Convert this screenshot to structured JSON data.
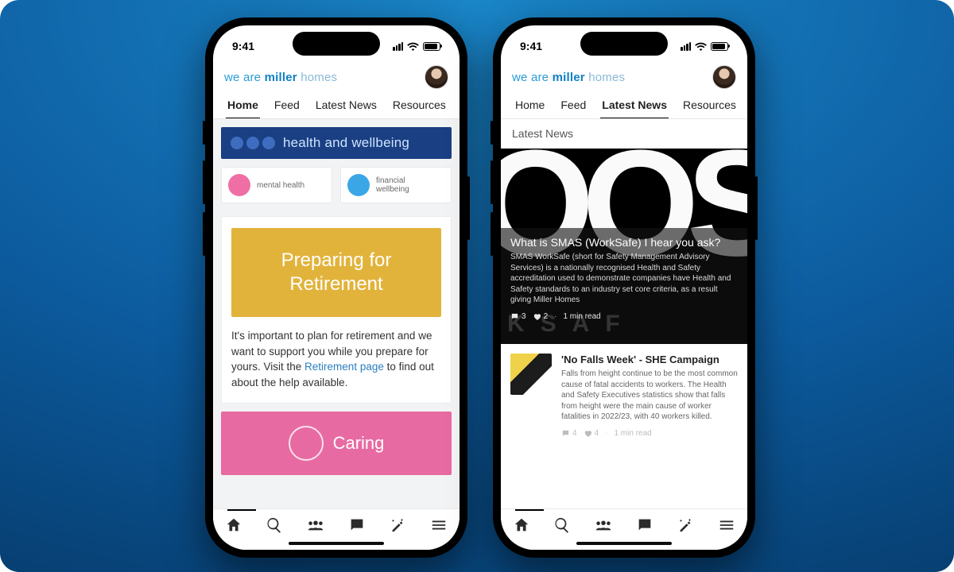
{
  "status": {
    "time": "9:41"
  },
  "brand": {
    "pre": "we are ",
    "bold": "miller",
    "post": " homes"
  },
  "tabs": [
    "Home",
    "Feed",
    "Latest News",
    "Resources"
  ],
  "phoneA": {
    "activeTab": 0,
    "hwBanner": "health and wellbeing",
    "tiles": {
      "mental": "mental health",
      "financial": "financial\nwellbeing"
    },
    "retire": {
      "bannerLine1": "Preparing for",
      "bannerLine2": "Retirement",
      "p_a": "It's important to plan for retirement and we want to support you while you prepare for yours. Visit the ",
      "link": "Retirement page",
      "p_b": " to find out about the help available."
    },
    "pinkWord": "Caring"
  },
  "phoneB": {
    "activeTab": 2,
    "sectionTitle": "Latest News",
    "feature": {
      "title": "What is SMAS (WorkSafe) I hear you ask?",
      "desc": "SMAS WorkSafe (short for Safety Management Advisory Services) is a nationally recognised Health and Safety accreditation used to demonstrate companies have Health and Safety standards to an industry set core criteria, as a result giving Miller Homes",
      "comments": "3",
      "likes": "2",
      "read": "1 min read"
    },
    "article2": {
      "title": "'No Falls Week' - SHE Campaign",
      "desc": "Falls from height continue to be the most common cause of fatal accidents to workers. The Health and Safety Executives statistics show that falls from height were the main cause of worker fatalities in 2022/23, with 40 workers killed.",
      "comments": "4",
      "likes": "4",
      "read": "1 min read"
    }
  }
}
